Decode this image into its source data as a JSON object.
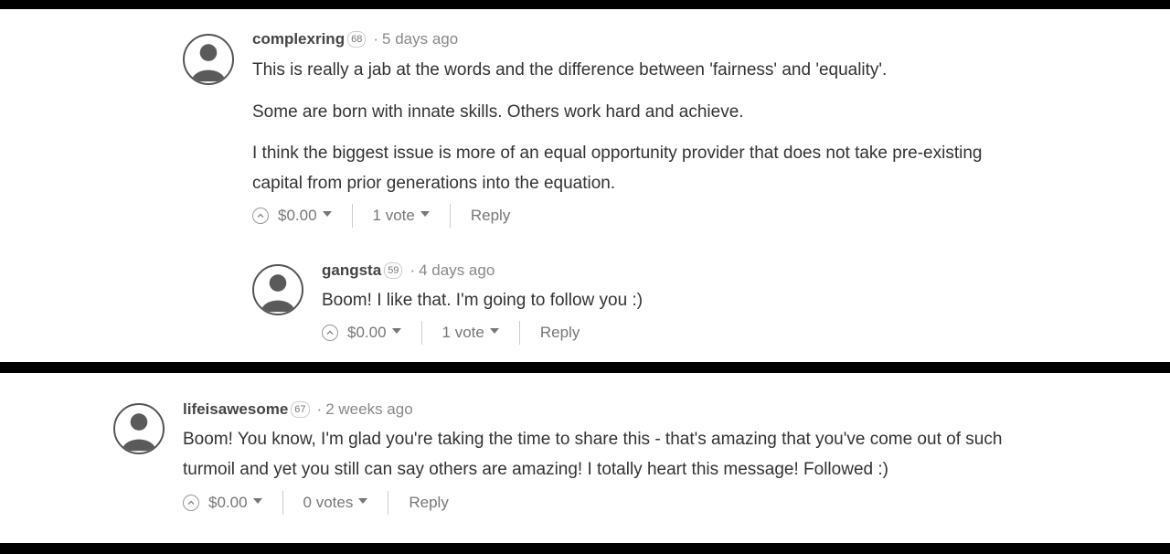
{
  "comments": [
    {
      "author": "complexring",
      "reputation": "68",
      "time": "5 days ago",
      "paragraphs": [
        "This is really a jab at the words and the difference between 'fairness' and 'equality'.",
        "Some are born with innate skills. Others work hard and achieve.",
        "I think the biggest issue is more of an equal opportunity provider that does not take pre-existing",
        "capital from prior generations into the equation."
      ],
      "payout": "$0.00",
      "votes": "1 vote",
      "reply": "Reply"
    },
    {
      "author": "gangsta",
      "reputation": "59",
      "time": "4 days ago",
      "paragraphs": [
        "Boom! I like that. I'm going to follow you :)"
      ],
      "payout": "$0.00",
      "votes": "1 vote",
      "reply": "Reply"
    },
    {
      "author": "lifeisawesome",
      "reputation": "67",
      "time": "2 weeks ago",
      "paragraphs": [
        "Boom! You know, I'm glad you're taking the time to share this - that's amazing that you've come out of such",
        "turmoil and yet you still can say others are amazing! I totally heart this message! Followed :)"
      ],
      "payout": "$0.00",
      "votes": "0 votes",
      "reply": "Reply"
    }
  ],
  "separator": "·",
  "icons": {
    "avatar": "user-silhouette-icon",
    "upvote": "chevron-up-circle-icon",
    "dropdown": "caret-down-icon"
  },
  "colors": {
    "background_frame": "#000000",
    "panel": "#ffffff",
    "text": "#333333",
    "muted": "#888888"
  }
}
